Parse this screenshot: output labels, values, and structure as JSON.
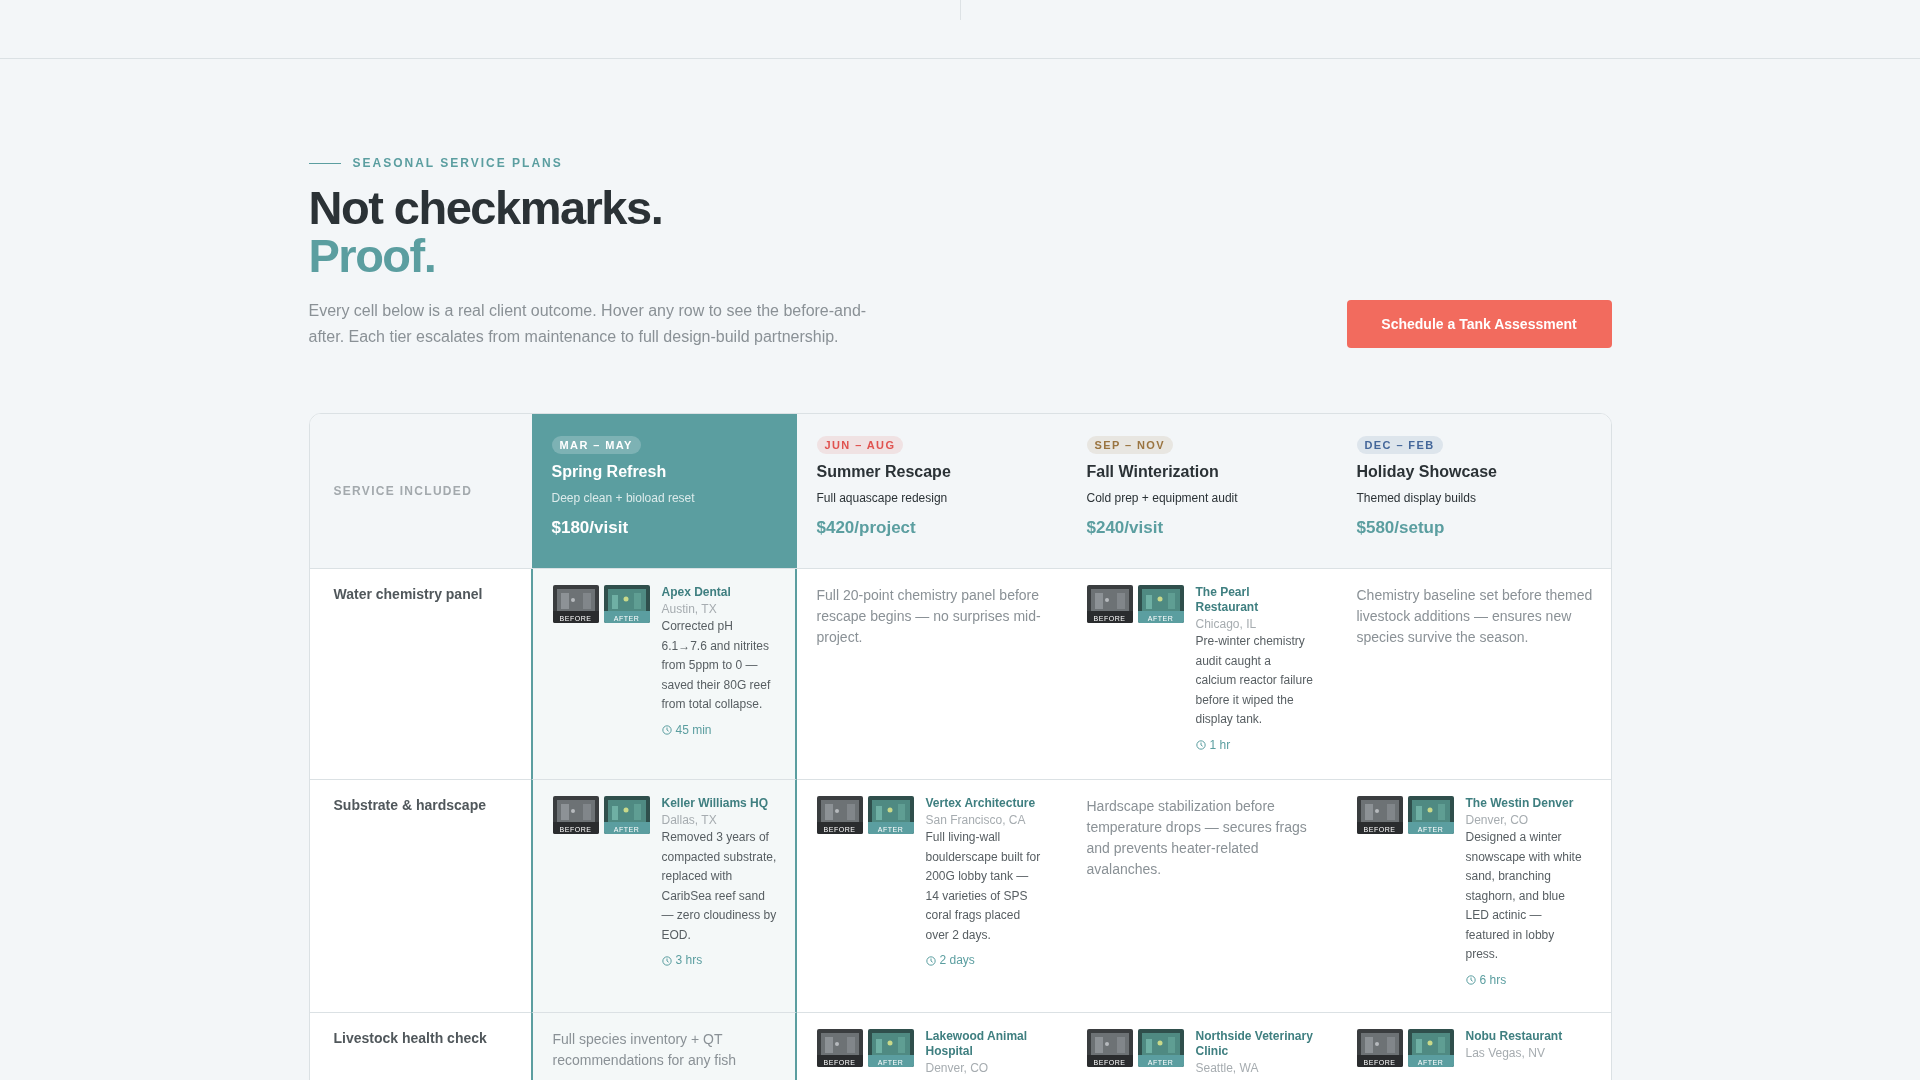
{
  "section": {
    "eyebrow": "SEASONAL SERVICE PLANS",
    "title": "Not checkmarks.",
    "title_accent": "Proof.",
    "intro": "Every cell below is a real client outcome. Hover any row to see the before-and-after. Each tier escalates from maintenance to full design-build partnership.",
    "cta": "Schedule a Tank Assessment"
  },
  "table": {
    "corner_label": "SERVICE INCLUDED",
    "plans": [
      {
        "season": "MAR – MAY",
        "color": "#7db2b4",
        "name": "Spring Refresh",
        "subtitle": "Deep clean + bioload reset",
        "price": "$180/visit",
        "selected": true
      },
      {
        "season": "JUN – AUG",
        "color": "#e0524f",
        "name": "Summer Rescape",
        "subtitle": "Full aquascape redesign",
        "price": "$420/project",
        "selected": false
      },
      {
        "season": "SEP – NOV",
        "color": "#9a7440",
        "name": "Fall Winterization",
        "subtitle": "Cold prep + equipment audit",
        "price": "$240/visit",
        "selected": false
      },
      {
        "season": "DEC – FEB",
        "color": "#44679a",
        "name": "Holiday Showcase",
        "subtitle": "Themed display builds",
        "price": "$580/setup",
        "selected": false
      }
    ],
    "rows": [
      {
        "service": "Water chemistry panel",
        "cells": [
          {
            "kind": "case",
            "before": "BEFORE",
            "after": "AFTER",
            "client": "Apex Dental",
            "location": "Austin, TX",
            "outcome": "Corrected pH 6.1→7.6 and nitrites from 5ppm to 0 — saved their 80G reef from total collapse.",
            "duration": "45 min"
          },
          {
            "kind": "text",
            "text": "Full 20-point chemistry panel before rescape begins — no surprises mid-project."
          },
          {
            "kind": "case",
            "before": "BEFORE",
            "after": "AFTER",
            "client": "The Pearl Restaurant",
            "location": "Chicago, IL",
            "outcome": "Pre-winter chemistry audit caught a calcium reactor failure before it wiped the display tank.",
            "duration": "1 hr"
          },
          {
            "kind": "text",
            "text": "Chemistry baseline set before themed livestock additions — ensures new species survive the season."
          }
        ]
      },
      {
        "service": "Substrate & hardscape",
        "cells": [
          {
            "kind": "case",
            "before": "BEFORE",
            "after": "AFTER",
            "client": "Keller Williams HQ",
            "location": "Dallas, TX",
            "outcome": "Removed 3 years of compacted substrate, replaced with CaribSea reef sand — zero cloudiness by EOD.",
            "duration": "3 hrs"
          },
          {
            "kind": "case",
            "before": "BEFORE",
            "after": "AFTER",
            "client": "Vertex Architecture",
            "location": "San Francisco, CA",
            "outcome": "Full living-wall boulderscape built for 200G lobby tank — 14 varieties of SPS coral frags placed over 2 days.",
            "duration": "2 days"
          },
          {
            "kind": "text",
            "text": "Hardscape stabilization before temperature drops — secures frags and prevents heater-related avalanches."
          },
          {
            "kind": "case",
            "before": "BEFORE",
            "after": "AFTER",
            "client": "The Westin Denver",
            "location": "Denver, CO",
            "outcome": "Designed a winter snowscape with white sand, branching staghorn, and blue LED actinic — featured in lobby press.",
            "duration": "6 hrs"
          }
        ]
      },
      {
        "service": "Livestock health check",
        "cells": [
          {
            "kind": "text",
            "text": "Full species inventory + QT recommendations for any fish"
          },
          {
            "kind": "case",
            "before": "BEFORE",
            "after": "AFTER",
            "client": "Lakewood Animal Hospital",
            "location": "Denver, CO"
          },
          {
            "kind": "case",
            "before": "BEFORE",
            "after": "AFTER",
            "client": "Northside Veterinary Clinic",
            "location": "Seattle, WA"
          },
          {
            "kind": "case",
            "before": "BEFORE",
            "after": "AFTER",
            "client": "Nobu Restaurant",
            "location": "Las Vegas, NV"
          }
        ]
      }
    ]
  }
}
